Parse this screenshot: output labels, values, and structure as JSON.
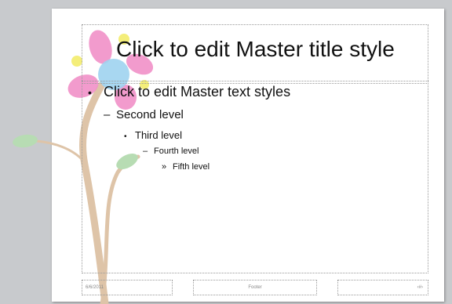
{
  "slide": {
    "title": "Click to edit Master title style",
    "levels": {
      "first": "Click to edit Master text styles",
      "second": "Second level",
      "third": "Third level",
      "fourth": "Fourth level",
      "fifth": "Fifth level"
    },
    "bullets": {
      "first": "•",
      "second": "–",
      "third": "•",
      "fourth": "–",
      "fifth": "»"
    },
    "footer": {
      "date": "6/6/2011",
      "text": "Footer",
      "number": "‹#›"
    }
  },
  "decoration": {
    "petal_color": "#f190c8",
    "center_color": "#9fd3ef",
    "dot_color": "#f4ee7a",
    "stem_color": "#dec4a8",
    "leaf_color": "#b7dcb3"
  }
}
